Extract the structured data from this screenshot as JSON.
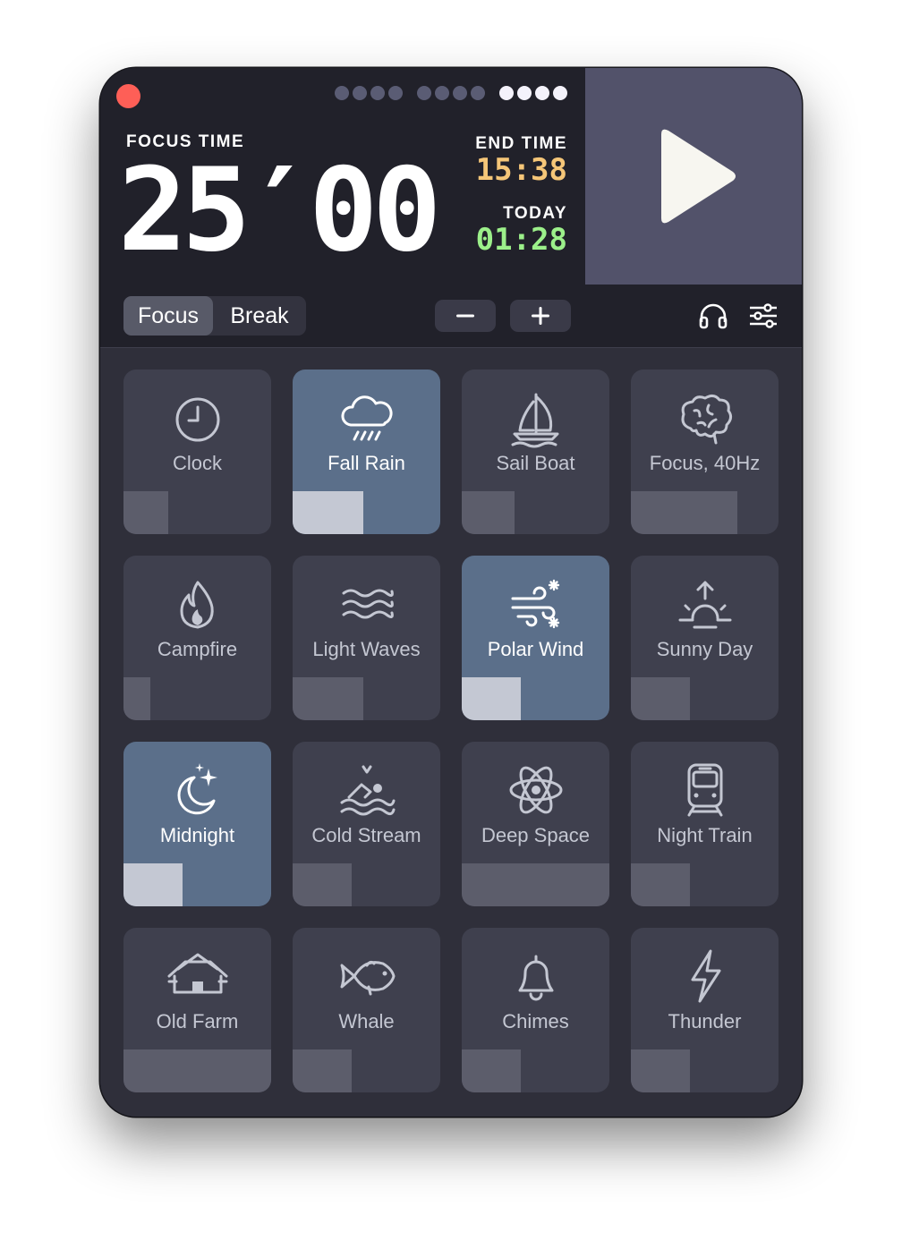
{
  "window": {
    "close_icon": "close-icon"
  },
  "session_dots": [
    [
      false,
      false,
      false,
      false
    ],
    [
      false,
      false,
      false,
      false
    ],
    [
      true,
      true,
      true,
      true
    ]
  ],
  "timer": {
    "focus_label": "FOCUS TIME",
    "time": "25′00",
    "end_label": "END TIME",
    "end_value": "15:38",
    "today_label": "TODAY",
    "today_value": "01:28",
    "play_icon": "play-icon"
  },
  "toolbar": {
    "modes": [
      "Focus",
      "Break"
    ],
    "active_mode": "Focus",
    "decrease_icon": "minus-icon",
    "increase_icon": "plus-icon",
    "headphones_icon": "headphones-icon",
    "settings_icon": "sliders-icon"
  },
  "colors": {
    "end_time": "#f5c678",
    "today": "#9cf08a",
    "active_tile": "#5b6f8a",
    "tile": "#3f404e",
    "close": "#fe5f57"
  },
  "sounds": [
    {
      "label": "Clock",
      "icon": "clock-icon",
      "active": false,
      "volume": 0.3
    },
    {
      "label": "Fall Rain",
      "icon": "rain-cloud-icon",
      "active": true,
      "volume": 0.48
    },
    {
      "label": "Sail Boat",
      "icon": "sailboat-icon",
      "active": false,
      "volume": 0.36
    },
    {
      "label": "Focus, 40Hz",
      "icon": "brain-icon",
      "active": false,
      "volume": 0.72
    },
    {
      "label": "Campfire",
      "icon": "flame-icon",
      "active": false,
      "volume": 0.18
    },
    {
      "label": "Light Waves",
      "icon": "waves-icon",
      "active": false,
      "volume": 0.48
    },
    {
      "label": "Polar Wind",
      "icon": "wind-snow-icon",
      "active": true,
      "volume": 0.4
    },
    {
      "label": "Sunny Day",
      "icon": "sunrise-icon",
      "active": false,
      "volume": 0.4
    },
    {
      "label": "Midnight",
      "icon": "moon-stars-icon",
      "active": true,
      "volume": 0.4
    },
    {
      "label": "Cold Stream",
      "icon": "swimmer-icon",
      "active": false,
      "volume": 0.4
    },
    {
      "label": "Deep Space",
      "icon": "atom-icon",
      "active": false,
      "volume": 1.0
    },
    {
      "label": "Night Train",
      "icon": "train-icon",
      "active": false,
      "volume": 0.4
    },
    {
      "label": "Old Farm",
      "icon": "farmhouse-icon",
      "active": false,
      "volume": 1.0
    },
    {
      "label": "Whale",
      "icon": "fish-icon",
      "active": false,
      "volume": 0.4
    },
    {
      "label": "Chimes",
      "icon": "bell-icon",
      "active": false,
      "volume": 0.4
    },
    {
      "label": "Thunder",
      "icon": "lightning-icon",
      "active": false,
      "volume": 0.4
    }
  ]
}
